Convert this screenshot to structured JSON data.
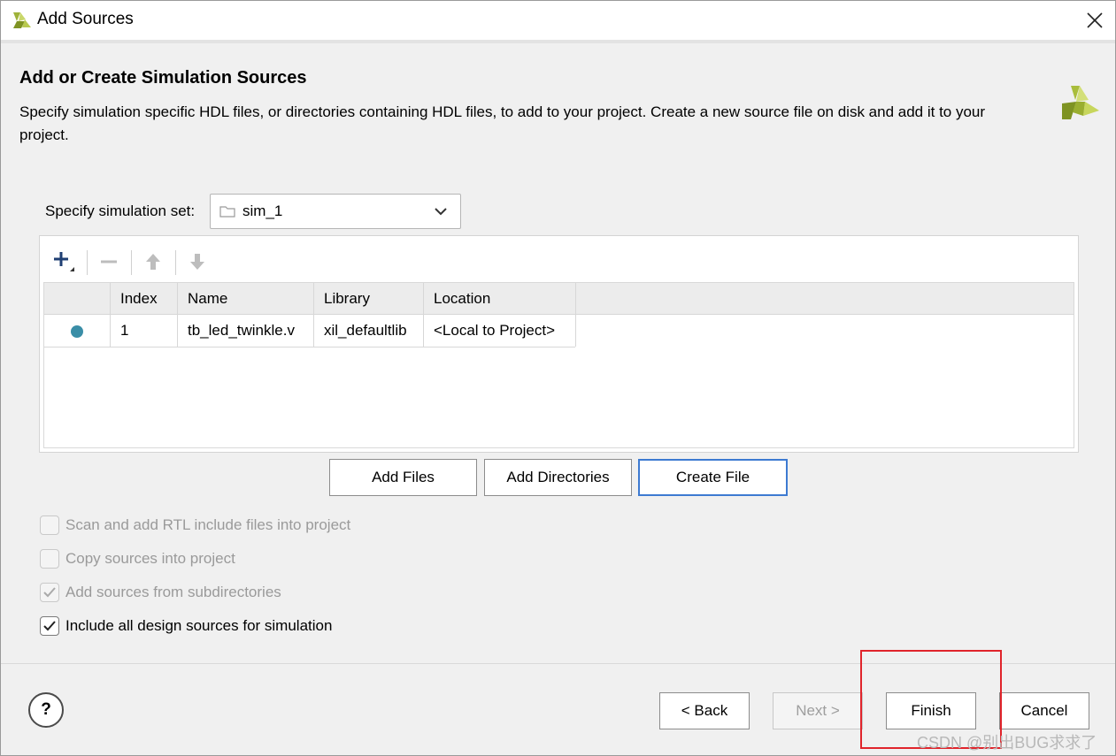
{
  "window": {
    "title": "Add Sources",
    "logo_icon": "vivado-logo-icon",
    "close_icon": "close-icon"
  },
  "header": {
    "heading": "Add or Create Simulation Sources",
    "description": "Specify simulation specific HDL files, or directories containing HDL files, to add to your project. Create a new source file on disk and add it to your project."
  },
  "simset": {
    "label": "Specify simulation set:",
    "value": "sim_1"
  },
  "toolbar": {
    "add_icon": "plus-icon",
    "remove_icon": "minus-icon",
    "up_icon": "arrow-up-icon",
    "down_icon": "arrow-down-icon"
  },
  "table": {
    "headers": [
      "",
      "Index",
      "Name",
      "Library",
      "Location"
    ],
    "rows": [
      {
        "status_color": "#3a8ea7",
        "index": "1",
        "name": "tb_led_twinkle.v",
        "library": "xil_defaultlib",
        "location": "<Local to Project>"
      }
    ]
  },
  "actions": {
    "add_files": "Add Files",
    "add_directories": "Add Directories",
    "create_file": "Create File"
  },
  "options": [
    {
      "label": "Scan and add RTL include files into project",
      "checked": false,
      "enabled": false
    },
    {
      "label": "Copy sources into project",
      "checked": false,
      "enabled": false
    },
    {
      "label": "Add sources from subdirectories",
      "checked": true,
      "enabled": false
    },
    {
      "label": "Include all design sources for simulation",
      "checked": true,
      "enabled": true
    }
  ],
  "footer": {
    "help": "?",
    "back": "< Back",
    "next": "Next >",
    "finish": "Finish",
    "cancel": "Cancel"
  },
  "watermark": "CSDN @别出BUG求求了"
}
